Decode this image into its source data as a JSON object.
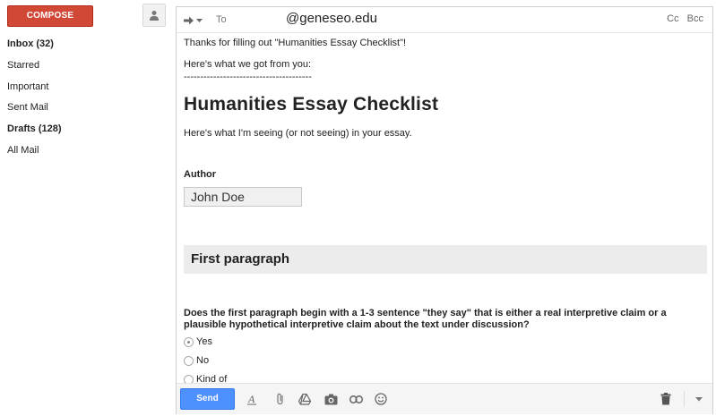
{
  "sidebar": {
    "compose_label": "COMPOSE",
    "items": [
      {
        "label": "Inbox (32)",
        "bold": true
      },
      {
        "label": "Starred",
        "bold": false
      },
      {
        "label": "Important",
        "bold": false
      },
      {
        "label": "Sent Mail",
        "bold": false
      },
      {
        "label": "Drafts (128)",
        "bold": true
      },
      {
        "label": "All Mail",
        "bold": false
      }
    ]
  },
  "compose": {
    "to_label": "To",
    "to_value": "@geneseo.edu",
    "cc_label": "Cc",
    "bcc_label": "Bcc",
    "body": {
      "intro": "Thanks for filling out \"Humanities Essay Checklist\"!",
      "subintro": "Here's what we got from you:",
      "divider": "---------------------------------------",
      "form_title": "Humanities Essay Checklist",
      "form_desc": "Here's what I'm seeing (or not seeing) in your essay.",
      "author_label": "Author",
      "author_value": "John Doe",
      "section_title": "First paragraph",
      "question": "Does the first paragraph begin with a 1-3 sentence \"they say\" that is either a real interpretive claim or a plausible hypothetical interpretive claim about the text under discussion?",
      "options": [
        {
          "label": "Yes",
          "checked": true
        },
        {
          "label": "No",
          "checked": false
        },
        {
          "label": "Kind of",
          "checked": false
        }
      ]
    },
    "toolbar": {
      "send_label": "Send",
      "icons": [
        "formatting-icon",
        "attach-icon",
        "drive-icon",
        "photo-icon",
        "link-icon",
        "emoji-icon",
        "trash-icon",
        "more-options-icon"
      ]
    }
  },
  "colors": {
    "compose_red": "#d14836",
    "send_blue": "#4d90fe",
    "section_gray": "#ececec"
  }
}
